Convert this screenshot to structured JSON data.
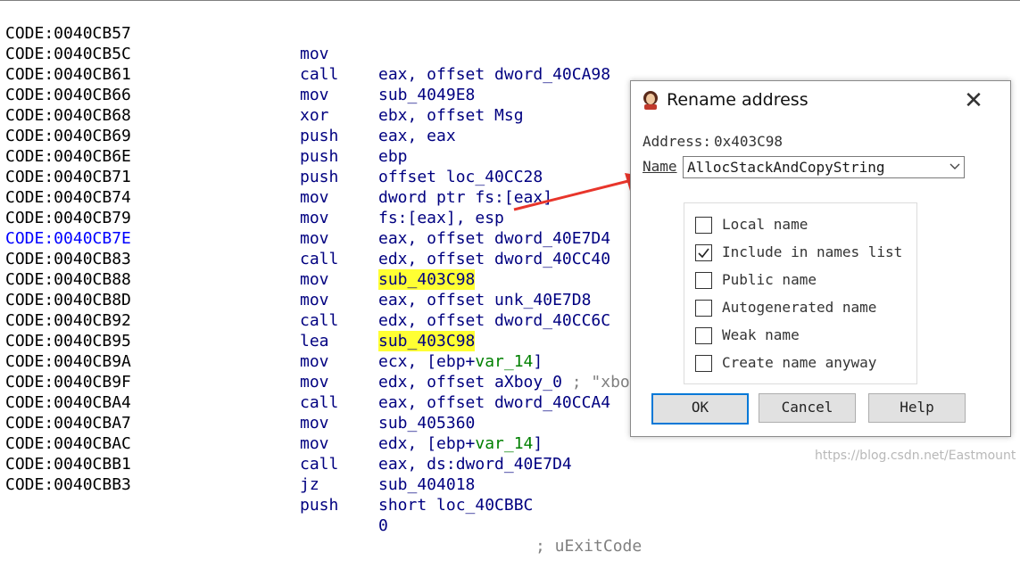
{
  "disassembly": {
    "rows": [
      {
        "address": "CODE:0040CB57",
        "mnemonic": "mov",
        "operands": "eax, offset dword_40CA98"
      },
      {
        "address": "CODE:0040CB5C",
        "mnemonic": "call",
        "operands": "sub_4049E8"
      },
      {
        "address": "CODE:0040CB61",
        "mnemonic": "mov",
        "operands": "ebx, offset Msg"
      },
      {
        "address": "CODE:0040CB66",
        "mnemonic": "xor",
        "operands": "eax, eax"
      },
      {
        "address": "CODE:0040CB68",
        "mnemonic": "push",
        "operands": "ebp"
      },
      {
        "address": "CODE:0040CB69",
        "mnemonic": "push",
        "operands": "offset loc_40CC28"
      },
      {
        "address": "CODE:0040CB6E",
        "mnemonic": "push",
        "operands": "dword ptr fs:[eax]"
      },
      {
        "address": "CODE:0040CB71",
        "mnemonic": "mov",
        "operands": "fs:[eax], esp"
      },
      {
        "address": "CODE:0040CB74",
        "mnemonic": "mov",
        "operands": "eax, offset dword_40E7D4"
      },
      {
        "address": "CODE:0040CB79",
        "mnemonic": "mov",
        "operands": "edx, offset dword_40CC40"
      },
      {
        "address": "CODE:0040CB7E",
        "mnemonic": "call",
        "operands": "sub_403C98"
      },
      {
        "address": "CODE:0040CB83",
        "mnemonic": "mov",
        "operands": "eax, offset unk_40E7D8"
      },
      {
        "address": "CODE:0040CB88",
        "mnemonic": "mov",
        "operands": "edx, offset dword_40CC6C"
      },
      {
        "address": "CODE:0040CB8D",
        "mnemonic": "call",
        "operands": "sub_403C98"
      },
      {
        "address": "CODE:0040CB92",
        "mnemonic": "lea",
        "operands_pre": "ecx, [ebp+",
        "operands_var": "var_14",
        "operands_post": "]"
      },
      {
        "address": "CODE:0040CB95",
        "mnemonic": "mov",
        "operands": "edx, offset aXboy_0",
        "comment": " ; \"xbo"
      },
      {
        "address": "CODE:0040CB9A",
        "mnemonic": "mov",
        "operands": "eax, offset dword_40CCA4"
      },
      {
        "address": "CODE:0040CB9F",
        "mnemonic": "call",
        "operands": "sub_405360"
      },
      {
        "address": "CODE:0040CBA4",
        "mnemonic": "mov",
        "operands_pre": "edx, [ebp+",
        "operands_var": "var_14",
        "operands_post": "]"
      },
      {
        "address": "CODE:0040CBA7",
        "mnemonic": "mov",
        "operands": "eax, ds:dword_40E7D4"
      },
      {
        "address": "CODE:0040CBAC",
        "mnemonic": "call",
        "operands": "sub_404018"
      },
      {
        "address": "CODE:0040CBB1",
        "mnemonic": "jz",
        "operands": "short loc_40CBBC"
      },
      {
        "address": "CODE:0040CBB3",
        "mnemonic": "push",
        "operands": "0",
        "comment": "; uExitCode"
      }
    ]
  },
  "dialog": {
    "title": "Rename address",
    "close_symbol": "✕",
    "address_label": "Address:",
    "address_value": "0x403C98",
    "name_label": "Name",
    "name_value": "AllocStackAndCopyString",
    "options": [
      {
        "label": "Local name",
        "checked": false
      },
      {
        "label": "Include in names list",
        "checked": true
      },
      {
        "label": "Public name",
        "checked": false
      },
      {
        "label": "Autogenerated name",
        "checked": false
      },
      {
        "label": "Weak name",
        "checked": false
      },
      {
        "label": "Create name anyway",
        "checked": false
      }
    ],
    "buttons": {
      "ok": "OK",
      "cancel": "Cancel",
      "help": "Help"
    }
  },
  "watermark": "https://blog.csdn.net/Eastmount",
  "colors": {
    "highlight": "#ffff33",
    "current_address": "#0000ff",
    "annotation_arrow": "#e8352b",
    "ok_border": "#0078d7"
  },
  "icons": {
    "title": "avatar-icon",
    "close": "close-icon",
    "combo": "chevron-down-icon",
    "checkmark": "checkmark-icon",
    "annotation": "arrow-annotation"
  }
}
